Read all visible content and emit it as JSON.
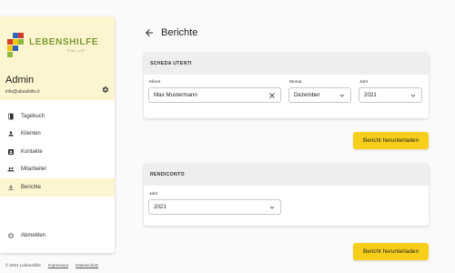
{
  "brand": {
    "name": "LEBENSHILFE",
    "sub": "ONLUS",
    "colors": {
      "green": "#7a9a33",
      "red": "#d23a2a",
      "blue": "#2e64b5",
      "yellow": "#f1c40f",
      "lightgreen": "#8fb83e"
    }
  },
  "user": {
    "name": "Admin",
    "email": "info@abusibilis.it"
  },
  "accent": "#f7cf1a",
  "nav": {
    "items": [
      {
        "label": "Tagebuch",
        "icon": "book-icon"
      },
      {
        "label": "Klienten",
        "icon": "person-icon"
      },
      {
        "label": "Kontakte",
        "icon": "contacts-icon"
      },
      {
        "label": "Mitarbeiter",
        "icon": "people-icon"
      },
      {
        "label": "Berichte",
        "icon": "download-icon"
      }
    ],
    "logout": {
      "label": "Abmelden",
      "icon": "power-icon"
    }
  },
  "footer": {
    "copyright": "© 2021 Lebenshilfe",
    "impressum": "Impressum",
    "datenschutz": "Datenschutz"
  },
  "page": {
    "title": "Berichte"
  },
  "card1": {
    "title": "SCHEDA UTENTI",
    "client_label": "Klient",
    "client_value": "Max Mustermann",
    "month_label": "Monat",
    "month_value": "Dezember",
    "year_label": "Jahr",
    "year_value": "2021",
    "button": "Bericht herunterladen"
  },
  "card2": {
    "title": "RENDICONTO",
    "year_label": "Jahr",
    "year_value": "2021",
    "button": "Bericht herunterladen"
  }
}
